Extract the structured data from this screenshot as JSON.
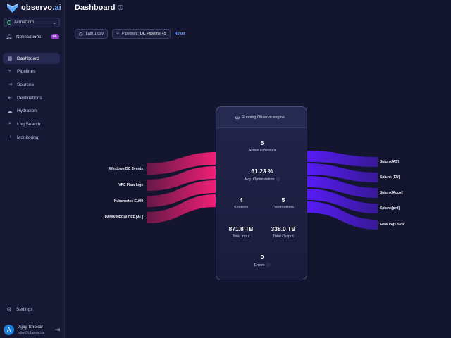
{
  "brand": {
    "name": "observo",
    "tld": ".ai"
  },
  "org": {
    "selected": "AcmeCorp"
  },
  "notifications": {
    "label": "Notifications",
    "badge": "6K"
  },
  "nav": [
    {
      "label": "Dashboard",
      "icon": "grid-icon",
      "active": true
    },
    {
      "label": "Pipelines",
      "icon": "pipelines-icon"
    },
    {
      "label": "Sources",
      "icon": "sources-icon"
    },
    {
      "label": "Destinations",
      "icon": "destinations-icon"
    },
    {
      "label": "Hydration",
      "icon": "cloud-icon"
    },
    {
      "label": "Log Search",
      "icon": "search-icon"
    },
    {
      "label": "Monitoring",
      "icon": "monitor-icon"
    }
  ],
  "settings": {
    "label": "Settings"
  },
  "user": {
    "initial": "A",
    "name": "Ajay Shekar",
    "email": "ajay@observo.ai"
  },
  "header": {
    "title": "Dashboard"
  },
  "filters": {
    "time": "Last 1 day",
    "pipelines_label": "Pipelines:",
    "pipelines_value": "DC Pipeline +5",
    "reset": "Reset"
  },
  "card": {
    "status": "Running Observo engine...",
    "active_pipelines": {
      "value": "6",
      "label": "Active Pipelines"
    },
    "optimization": {
      "value": "61.23 %",
      "label": "Avg. Optimization"
    },
    "sources": {
      "value": "4",
      "label": "Sources"
    },
    "destinations": {
      "value": "5",
      "label": "Destinations"
    },
    "total_input": {
      "value": "871.8 TB",
      "label": "Total input"
    },
    "total_output": {
      "value": "338.0 TB",
      "label": "Total Output"
    },
    "errors": {
      "value": "0",
      "label": "Errors"
    }
  },
  "flow": {
    "sources": [
      "Windows DC Events",
      "VPC Flow logs",
      "Kubernetes EU09",
      "PANW NFGW CEF [AL]"
    ],
    "destinations": [
      "Splunk[AS]",
      "Splunk [EU]",
      "Splunk[Apps]",
      "Splunk[prd]",
      "Flow logs Sink"
    ],
    "source_color": "#ff1f7a",
    "destination_color": "#5b1cff"
  }
}
